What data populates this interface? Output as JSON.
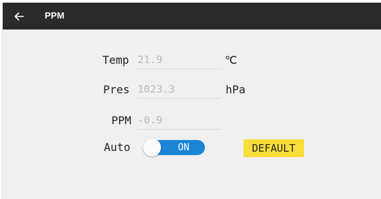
{
  "appbar": {
    "title": "PPM",
    "back_icon": "arrow-back-icon"
  },
  "form": {
    "temp": {
      "label": "Temp",
      "value": "21.9",
      "unit": "℃"
    },
    "pres": {
      "label": "Pres",
      "value": "1023.3",
      "unit": "hPa"
    },
    "ppm": {
      "label": "PPM",
      "value": "-0.9"
    }
  },
  "auto": {
    "label": "Auto",
    "toggle_text": "ON",
    "toggle_on": true,
    "accent_color": "#1a84d6"
  },
  "default_button": {
    "label": "DEFAULT",
    "color": "#f9dd3b"
  },
  "colors": {
    "appbar": "#2b2b2b",
    "background": "#f0f0f0"
  }
}
